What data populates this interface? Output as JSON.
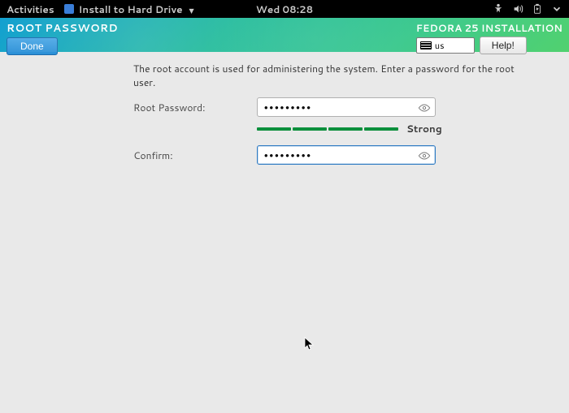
{
  "gnome": {
    "activities": "Activities",
    "app_name": "Install to Hard Drive",
    "clock": "Wed 08:28"
  },
  "header": {
    "title": "ROOT PASSWORD",
    "subtitle": "FEDORA 25 INSTALLATION",
    "done_label": "Done",
    "kbd_layout": "us",
    "help_label": "Help!"
  },
  "main": {
    "intro": "The root account is used for administering the system.  Enter a password for the root user.",
    "password_label": "Root Password:",
    "password_value": "•••••••••",
    "confirm_label": "Confirm:",
    "confirm_value": "•••••••••",
    "strength_label": "Strong"
  }
}
